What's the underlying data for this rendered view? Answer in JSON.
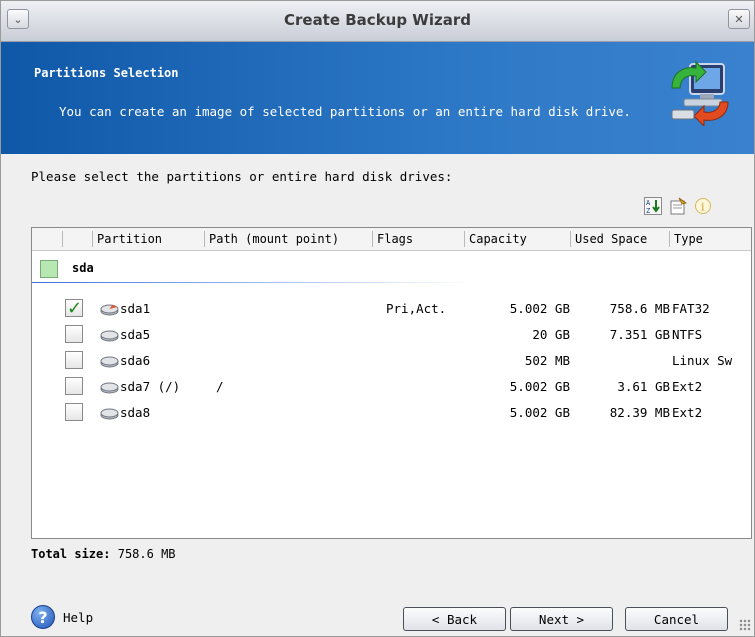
{
  "window": {
    "title": "Create Backup Wizard",
    "menu_glyph": "⌄",
    "close_glyph": "✕"
  },
  "banner": {
    "title": "Partitions Selection",
    "description": "You can create an image of selected partitions or an entire hard disk drive."
  },
  "prompt": "Please select the partitions or entire hard disk drives:",
  "toolbar": {
    "icons": [
      "sort-icon",
      "properties-icon",
      "info-icon"
    ]
  },
  "table": {
    "columns": [
      "Partition",
      "Path (mount point)",
      "Flags",
      "Capacity",
      "Used Space",
      "Type"
    ],
    "disk": {
      "name": "sda",
      "checked": false
    },
    "rows": [
      {
        "name": "sda1",
        "path": "",
        "flags": "Pri,Act.",
        "capacity": "5.002 GB",
        "used": "758.6 MB",
        "type": "FAT32",
        "checked": true
      },
      {
        "name": "sda5",
        "path": "",
        "flags": "",
        "capacity": "20 GB",
        "used": "7.351 GB",
        "type": "NTFS",
        "checked": false
      },
      {
        "name": "sda6",
        "path": "",
        "flags": "",
        "capacity": "502 MB",
        "used": "",
        "type": "Linux Sw",
        "checked": false
      },
      {
        "name": "sda7 (/)",
        "path": "/",
        "flags": "",
        "capacity": "5.002 GB",
        "used": "3.61 GB",
        "type": "Ext2",
        "checked": false
      },
      {
        "name": "sda8",
        "path": "",
        "flags": "",
        "capacity": "5.002 GB",
        "used": "82.39 MB",
        "type": "Ext2",
        "checked": false
      }
    ]
  },
  "total": {
    "label": "Total size:",
    "value": "758.6 MB"
  },
  "buttons": {
    "help": "Help",
    "back": "< Back",
    "next": "Next >",
    "cancel": "Cancel"
  },
  "colors": {
    "banner": "#1a64b8",
    "check": "#1c8a1c",
    "disk_checkbox": "#b7e8b2"
  }
}
